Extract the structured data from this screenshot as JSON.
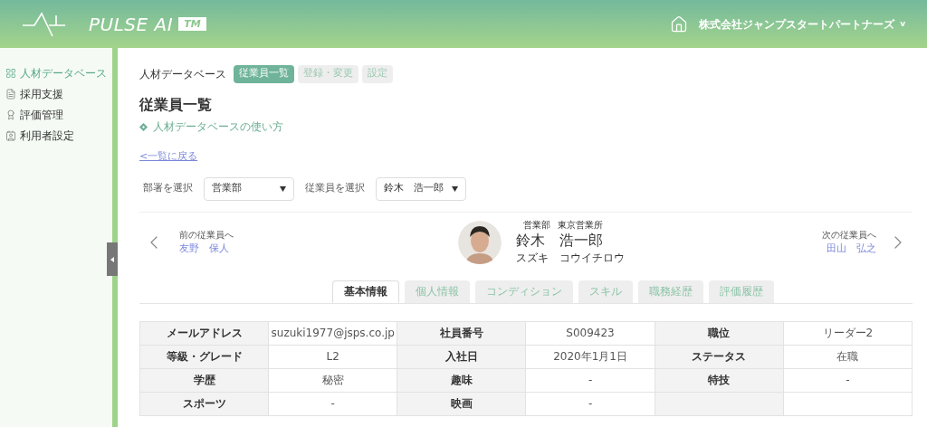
{
  "header": {
    "brand": "PULSE AI",
    "trademark": "TM",
    "company": "株式会社ジャンプスタートパートナーズ",
    "company_caret": "v"
  },
  "sidebar": {
    "items": [
      {
        "label": "人材データベース",
        "selected": true,
        "kind": "grid"
      },
      {
        "label": "採用支援",
        "selected": false,
        "kind": "doc"
      },
      {
        "label": "評価管理",
        "selected": false,
        "kind": "award"
      },
      {
        "label": "利用者設定",
        "selected": false,
        "kind": "user"
      }
    ]
  },
  "breadcrumb": {
    "label": "人材データベース",
    "tabs": [
      {
        "label": "従業員一覧",
        "selected": true
      },
      {
        "label": "登録・変更",
        "selected": false
      },
      {
        "label": "設定",
        "selected": false
      }
    ]
  },
  "title": "従業員一覧",
  "help_link": "人材データベースの使い方",
  "back_link": "<一覧に戻る",
  "filters": [
    {
      "label": "部署を選択",
      "value": "営業部"
    },
    {
      "label": "従業員を選択",
      "value": "鈴木　浩一郎"
    }
  ],
  "employee": {
    "department": "営業部",
    "office": "東京営業所",
    "name": "鈴木　浩一郎",
    "kana": "スズキ　コウイチロウ"
  },
  "prev": {
    "caption": "前の従業員へ",
    "name": "友野　保人"
  },
  "next": {
    "caption": "次の従業員へ",
    "name": "田山　弘之"
  },
  "tabs": [
    {
      "label": "基本情報",
      "selected": true
    },
    {
      "label": "個人情報",
      "selected": false
    },
    {
      "label": "コンディション",
      "selected": false
    },
    {
      "label": "スキル",
      "selected": false
    },
    {
      "label": "職務経歴",
      "selected": false
    },
    {
      "label": "評価履歴",
      "selected": false
    }
  ],
  "table": {
    "rows": [
      {
        "cells": [
          {
            "kind": "header",
            "text": "メールアドレス"
          },
          {
            "kind": "value",
            "text": "suzuki1977@jsps.co.jp"
          },
          {
            "kind": "header",
            "text": "社員番号"
          },
          {
            "kind": "value",
            "text": "S009423"
          },
          {
            "kind": "header",
            "text": "職位"
          },
          {
            "kind": "value",
            "text": "リーダー2"
          }
        ]
      },
      {
        "cells": [
          {
            "kind": "header",
            "text": "等級・グレード"
          },
          {
            "kind": "value",
            "text": "L2"
          },
          {
            "kind": "header",
            "text": "入社日"
          },
          {
            "kind": "value",
            "text": "2020年1月1日"
          },
          {
            "kind": "header",
            "text": "ステータス"
          },
          {
            "kind": "value",
            "text": "在職"
          }
        ]
      },
      {
        "cells": [
          {
            "kind": "header",
            "text": "学歴"
          },
          {
            "kind": "value",
            "text": "秘密"
          },
          {
            "kind": "header",
            "text": "趣味"
          },
          {
            "kind": "value",
            "text": "-"
          },
          {
            "kind": "header",
            "text": "特技"
          },
          {
            "kind": "value",
            "text": "-"
          }
        ]
      },
      {
        "cells": [
          {
            "kind": "header",
            "text": "スポーツ"
          },
          {
            "kind": "value",
            "text": "-"
          },
          {
            "kind": "header",
            "text": "映画"
          },
          {
            "kind": "value",
            "text": "-"
          },
          {
            "kind": "header"
          },
          {
            "kind": "value"
          }
        ]
      }
    ]
  }
}
